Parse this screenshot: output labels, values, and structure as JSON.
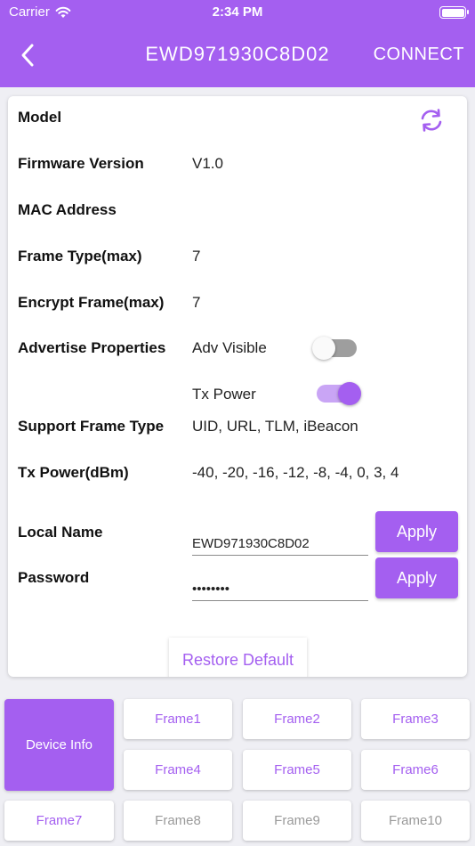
{
  "status_bar": {
    "carrier": "Carrier",
    "time": "2:34 PM"
  },
  "nav": {
    "title": "EWD971930C8D02",
    "connect_label": "CONNECT"
  },
  "info": {
    "model_label": "Model",
    "firmware_label": "Firmware Version",
    "firmware_value": "V1.0",
    "mac_label": "MAC Address",
    "frame_type_label": "Frame Type(max)",
    "frame_type_value": "7",
    "encrypt_label": "Encrypt Frame(max)",
    "encrypt_value": "7",
    "advertise_label": "Advertise Properties",
    "adv_visible_label": "Adv Visible",
    "adv_visible_on": false,
    "tx_power_toggle_label": "Tx Power",
    "tx_power_toggle_on": true,
    "support_label": "Support Frame Type",
    "support_value": "UID, URL, TLM, iBeacon",
    "tx_dbm_label": "Tx Power(dBm)",
    "tx_dbm_value": "-40, -20, -16, -12, -8, -4, 0, 3, 4"
  },
  "form": {
    "local_name_label": "Local Name",
    "local_name_value": "EWD971930C8D02",
    "password_label": "Password",
    "password_value": "88888888",
    "apply_label": "Apply",
    "restore_label": "Restore Default"
  },
  "tabs": {
    "device_info": "Device Info",
    "frame1": "Frame1",
    "frame2": "Frame2",
    "frame3": "Frame3",
    "frame4": "Frame4",
    "frame5": "Frame5",
    "frame6": "Frame6",
    "frame7": "Frame7",
    "frame8": "Frame8",
    "frame9": "Frame9",
    "frame10": "Frame10"
  },
  "colors": {
    "accent": "#a45ff0",
    "background": "#efeff4",
    "disabled_text": "#9a9a9a"
  },
  "icons": {
    "back": "chevron-left-icon",
    "refresh": "refresh-icon",
    "wifi": "wifi-icon",
    "battery": "battery-icon"
  }
}
